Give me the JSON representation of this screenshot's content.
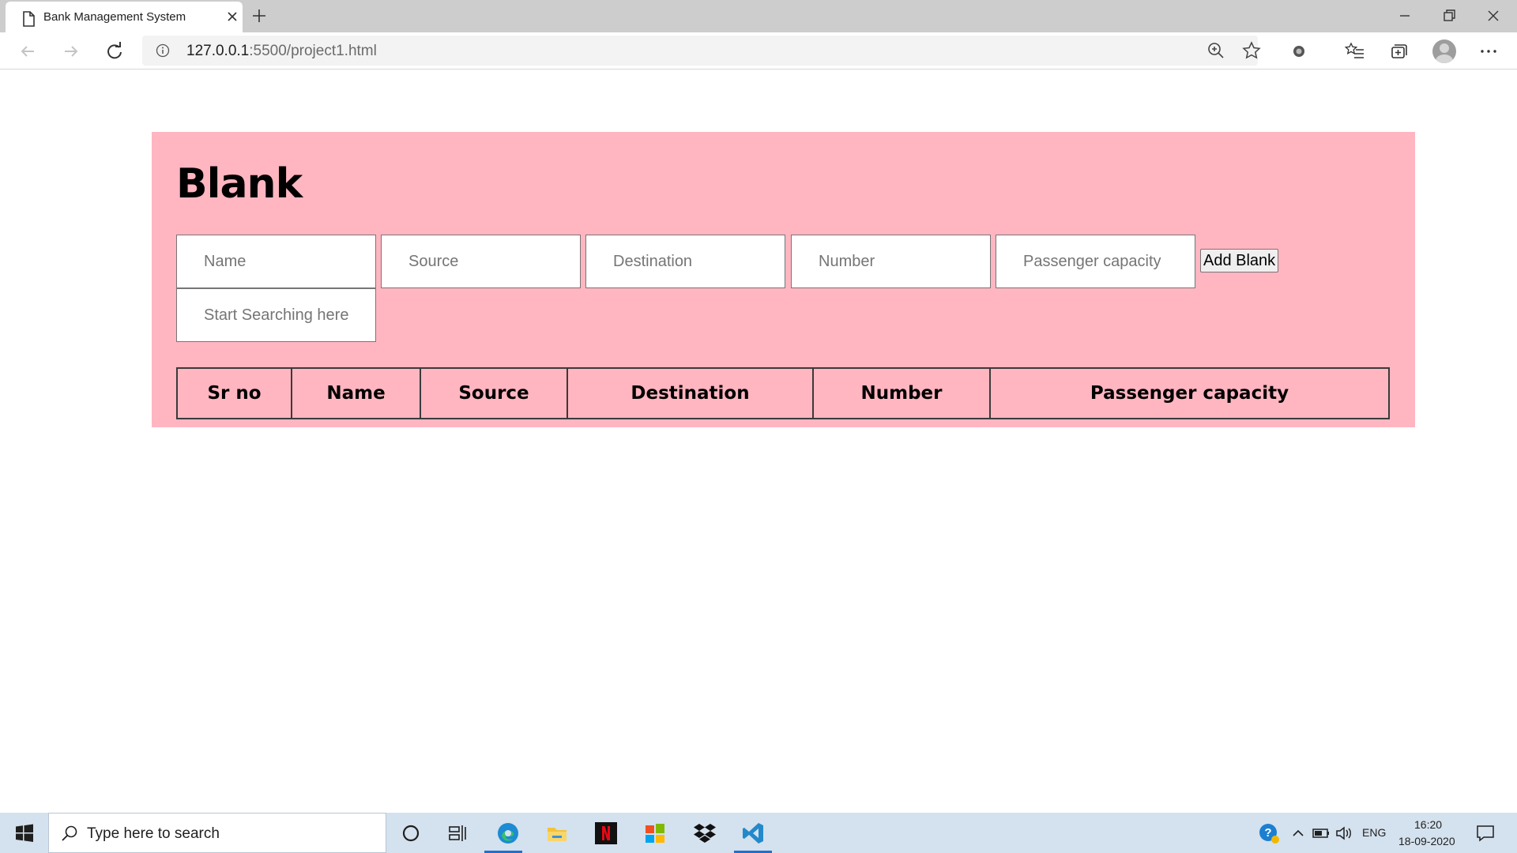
{
  "browser": {
    "tab_title": "Bank Management System",
    "url_host": "127.0.0.1",
    "url_rest": ":5500/project1.html"
  },
  "page": {
    "heading": "Blank",
    "fields": {
      "name_placeholder": "Name",
      "source_placeholder": "Source",
      "destination_placeholder": "Destination",
      "number_placeholder": "Number",
      "capacity_placeholder": "Passenger capacity",
      "search_placeholder": "Start Searching here"
    },
    "add_button": "Add Blank",
    "table_headers": [
      "Sr no",
      "Name",
      "Source",
      "Destination",
      "Number",
      "Passenger capacity"
    ],
    "panel_color": "#ffb6c1"
  },
  "taskbar": {
    "search_placeholder": "Type here to search",
    "language": "ENG",
    "time": "16:20",
    "date": "18-09-2020"
  }
}
